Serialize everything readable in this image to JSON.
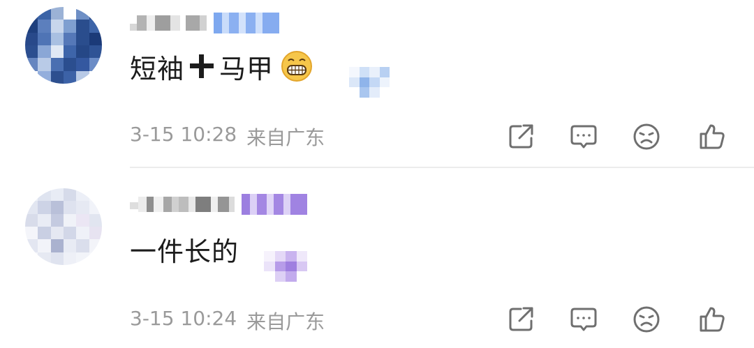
{
  "comments": [
    {
      "content_parts": [
        "短袖",
        "马甲"
      ],
      "emoji": "grinning-face-emoji",
      "date": "3-15 10:28",
      "location": "来自广东",
      "badge_color": "#7ea8ef"
    },
    {
      "content_parts": [
        "一件长的"
      ],
      "date": "3-15 10:24",
      "location": "来自广东",
      "badge_color": "#9c7fe0"
    }
  ],
  "actions": [
    "share-icon",
    "comment-icon",
    "dislike-icon",
    "like-icon"
  ],
  "colors": {
    "text": "#1c1c1c",
    "meta": "#9a9a9a",
    "icon": "#6f6f6f",
    "divider": "#ececec"
  }
}
